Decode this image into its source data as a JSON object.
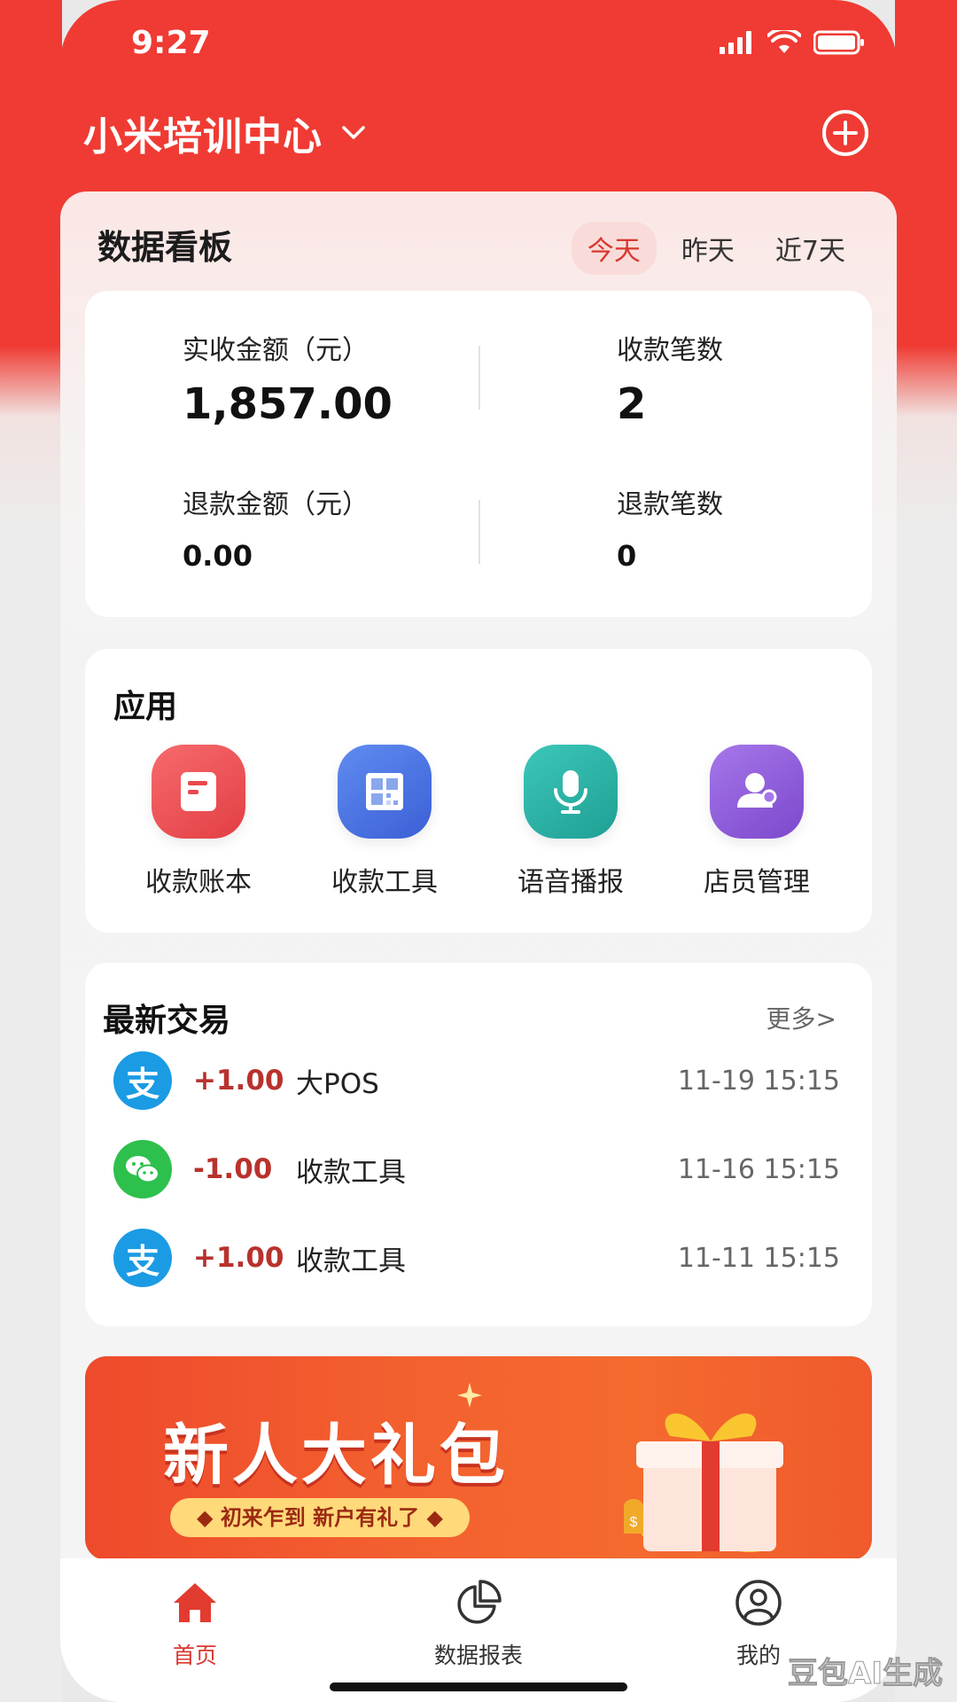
{
  "status_bar": {
    "time": "9:27"
  },
  "header": {
    "shop_name": "小米培训中心"
  },
  "dashboard": {
    "title": "数据看板",
    "ranges": [
      "今天",
      "昨天",
      "近7天"
    ],
    "active_range": "今天",
    "received_amount_label": "实收金额（元）",
    "received_amount": "1,857.00",
    "payment_count_label": "收款笔数",
    "payment_count": "2",
    "refund_amount_label": "退款金额（元）",
    "refund_amount": "0.00",
    "refund_count_label": "退款笔数",
    "refund_count": "0"
  },
  "apps": {
    "title": "应用",
    "items": [
      {
        "label": "收款账本",
        "icon": "ledger-icon",
        "color": "#ee4f52"
      },
      {
        "label": "收款工具",
        "icon": "qrcode-icon",
        "color": "#4a74e3"
      },
      {
        "label": "语音播报",
        "icon": "microphone-icon",
        "color": "#27b0a4"
      },
      {
        "label": "店员管理",
        "icon": "staff-icon",
        "color": "#8d5bd8"
      }
    ]
  },
  "transactions": {
    "title": "最新交易",
    "more": "更多>",
    "rows": [
      {
        "method_icon": "alipay-icon",
        "amount": "+1.00",
        "desc": "大POS",
        "time": "11-19 15:15"
      },
      {
        "method_icon": "wechat-pay-icon",
        "amount": "-1.00",
        "desc": "收款工具",
        "time": "11-16 15:15"
      },
      {
        "method_icon": "alipay-icon",
        "amount": "+1.00",
        "desc": "收款工具",
        "time": "11-11 15:15"
      }
    ]
  },
  "banner": {
    "title": "新人大礼包",
    "subtitle": "◆ 初来乍到  新户有礼了 ◆"
  },
  "tabbar": {
    "items": [
      {
        "label": "首页",
        "icon": "home-icon",
        "active": true
      },
      {
        "label": "数据报表",
        "icon": "pie-chart-icon",
        "active": false
      },
      {
        "label": "我的",
        "icon": "user-icon",
        "active": false
      }
    ]
  },
  "watermark": "豆包AI生成",
  "colors": {
    "primary": "#ef3b33",
    "amount": "#b8322d",
    "alipay": "#1b9be4",
    "wechat": "#2dc04d"
  }
}
